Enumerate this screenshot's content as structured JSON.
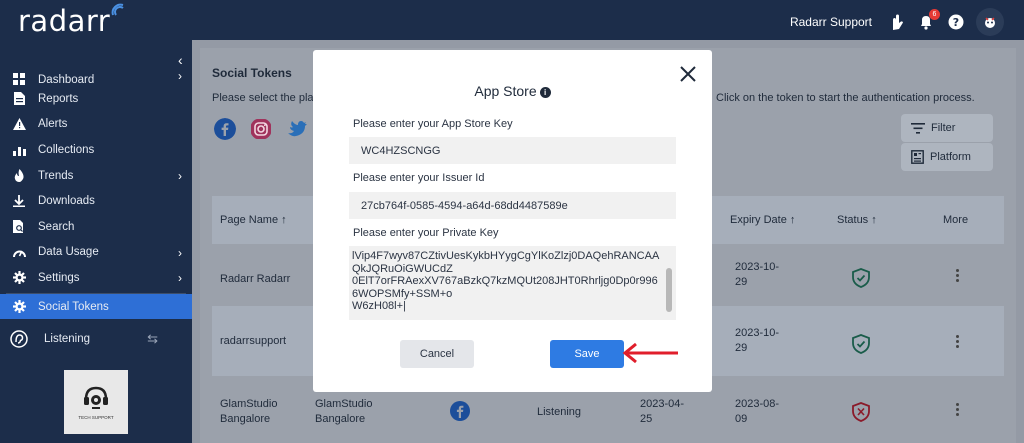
{
  "app": {
    "logo": "radarr",
    "user_name": "Radarr Support",
    "notification_count": "6"
  },
  "sidebar": {
    "items": [
      {
        "label": "Dashboard",
        "icon": "dashboard-icon",
        "has_submenu": true
      },
      {
        "label": "Reports",
        "icon": "reports-icon",
        "has_submenu": false
      },
      {
        "label": "Alerts",
        "icon": "alert-icon",
        "has_submenu": false
      },
      {
        "label": "Collections",
        "icon": "collections-icon",
        "has_submenu": false
      },
      {
        "label": "Trends",
        "icon": "trends-icon",
        "has_submenu": true
      },
      {
        "label": "Downloads",
        "icon": "download-icon",
        "has_submenu": false
      },
      {
        "label": "Search",
        "icon": "search-icon",
        "has_submenu": false
      },
      {
        "label": "Data Usage",
        "icon": "data-usage-icon",
        "has_submenu": true
      },
      {
        "label": "Settings",
        "icon": "gear-icon",
        "has_submenu": true
      },
      {
        "label": "Social Tokens",
        "icon": "social-tokens-icon",
        "has_submenu": false,
        "active": true
      }
    ],
    "listening": "Listening",
    "tech_support_label": "TECH SUPPORT"
  },
  "main": {
    "title": "Social Tokens",
    "desc_left": "Please select the pla",
    "desc_right": "Click on the token to start the authentication process.",
    "filter_label": "Filter",
    "platform_label": "Platform",
    "columns": [
      "Page Name",
      "Expiry Date",
      "Status",
      "More"
    ],
    "rows": [
      {
        "page": "Radarr Radarr",
        "expiry": "2023-10-\n29",
        "status": "ok"
      },
      {
        "page": "radarrsupport",
        "expiry": "2023-10-\n29",
        "status": "ok"
      },
      {
        "page": "GlamStudio\nBangalore",
        "page2": "GlamStudio\nBangalore",
        "type": "Listening",
        "created": "2023-04-\n25",
        "expiry": "2023-08-\n09",
        "status": "warn"
      }
    ]
  },
  "modal": {
    "title": "App Store",
    "key_label": "Please enter your App Store Key",
    "key_value": "WC4HZSCNGG",
    "issuer_label": "Please enter your Issuer Id",
    "issuer_value": "27cb764f-0585-4594-a64d-68dd4487589e",
    "private_label": "Please enter your Private Key",
    "private_value": "lVip4F7wyv87CZtivUesKykbHYygCgYlKoZlzj0DAQehRANCAAQkJQRuOiGWUCdZ\n0ElT7orFRAexXV767aBzkQ7kzMQUt208JHT0Rhrljg0Dp0r9966WOPSMfy+SSM+o\nW6zH08l+|",
    "cancel_label": "Cancel",
    "save_label": "Save"
  },
  "colors": {
    "accent": "#2e7be3",
    "sidebar_bg": "#1c2d4a",
    "active_nav": "#2e6fd6",
    "arrow": "#e01e2b"
  }
}
